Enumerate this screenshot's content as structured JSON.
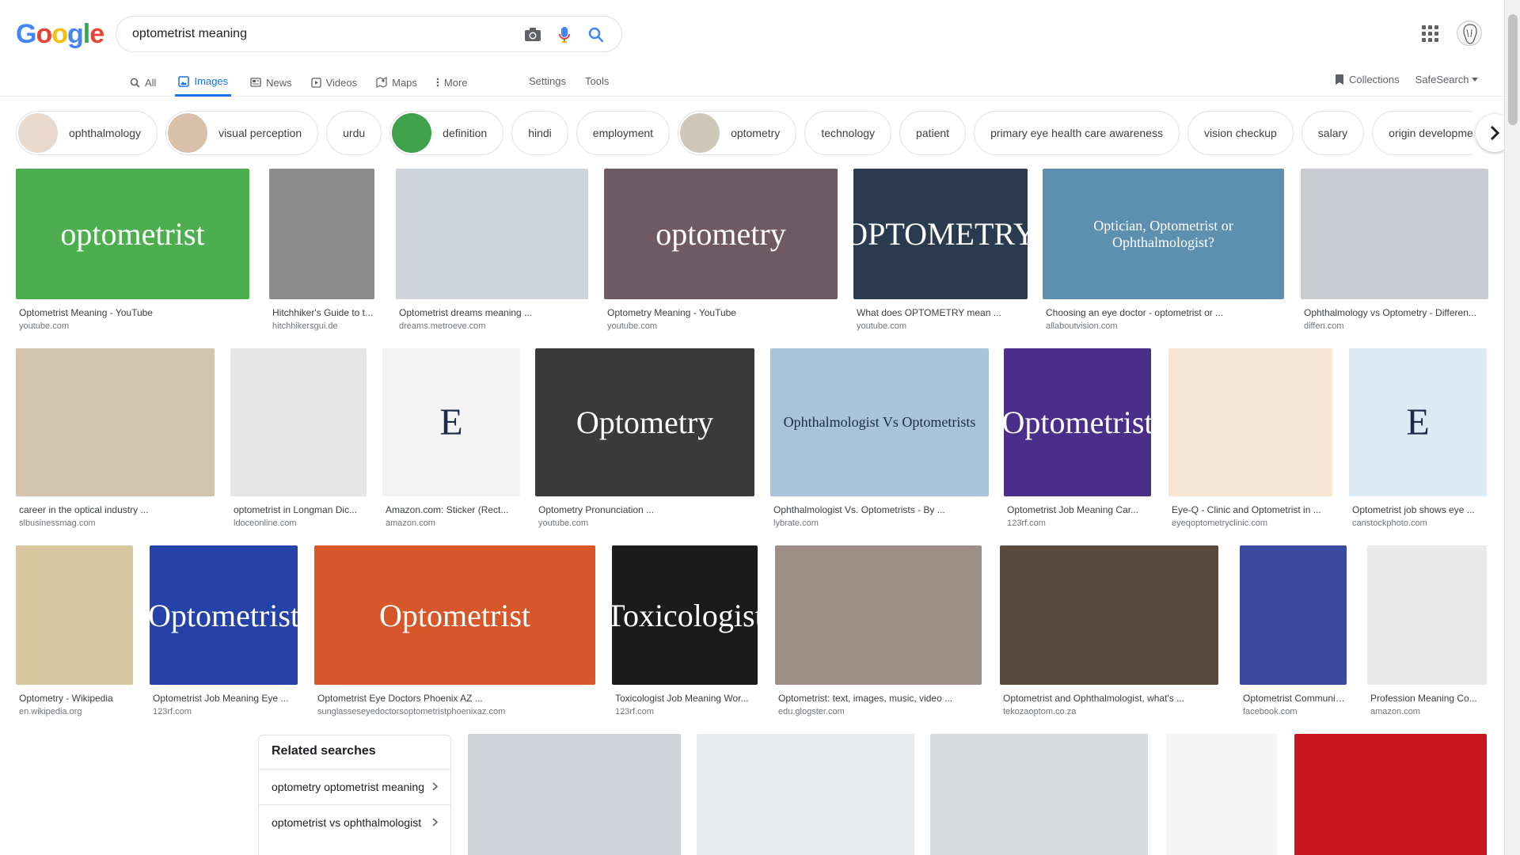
{
  "header": {
    "logo_letters": [
      {
        "ch": "G",
        "color": "#4285F4"
      },
      {
        "ch": "o",
        "color": "#EA4335"
      },
      {
        "ch": "o",
        "color": "#FBBC05"
      },
      {
        "ch": "g",
        "color": "#4285F4"
      },
      {
        "ch": "l",
        "color": "#34A853"
      },
      {
        "ch": "e",
        "color": "#EA4335"
      }
    ],
    "search_query": "optometrist meaning"
  },
  "nav": {
    "tabs": [
      {
        "label": "All",
        "icon": "search-icon",
        "active": false
      },
      {
        "label": "Images",
        "icon": "image-icon",
        "active": true
      },
      {
        "label": "News",
        "icon": "news-icon",
        "active": false
      },
      {
        "label": "Videos",
        "icon": "video-icon",
        "active": false
      },
      {
        "label": "Maps",
        "icon": "map-icon",
        "active": false
      },
      {
        "label": "More",
        "icon": "more-icon",
        "active": false
      }
    ],
    "settings": "Settings",
    "tools": "Tools",
    "collections": "Collections",
    "safesearch": "SafeSearch"
  },
  "chips": [
    {
      "label": "ophthalmology",
      "thumb": true,
      "thumb_color": "#e8d9cc"
    },
    {
      "label": "visual perception",
      "thumb": true,
      "thumb_color": "#d9c0a8"
    },
    {
      "label": "urdu",
      "thumb": false
    },
    {
      "label": "definition",
      "thumb": true,
      "thumb_color": "#3fa24a"
    },
    {
      "label": "hindi",
      "thumb": false
    },
    {
      "label": "employment",
      "thumb": false
    },
    {
      "label": "optometry",
      "thumb": true,
      "thumb_color": "#cfc8b8"
    },
    {
      "label": "technology",
      "thumb": false
    },
    {
      "label": "patient",
      "thumb": false
    },
    {
      "label": "primary eye health care awareness",
      "thumb": false
    },
    {
      "label": "vision checkup",
      "thumb": false
    },
    {
      "label": "salary",
      "thumb": false
    },
    {
      "label": "origin development",
      "thumb": false
    }
  ],
  "images": [
    {
      "title": "Optometrist Meaning - YouTube",
      "source": "youtube.com",
      "bg": "#4cae4f",
      "text": "optometrist"
    },
    {
      "title": "Hitchhiker's Guide to t...",
      "source": "hitchhikersgui.de",
      "bg": "#8c8c8c",
      "text": ""
    },
    {
      "title": "Optometrist dreams meaning ...",
      "source": "dreams.metroeve.com",
      "bg": "#cfd5db",
      "text": ""
    },
    {
      "title": "Optometry Meaning - YouTube",
      "source": "youtube.com",
      "bg": "#6f5a63",
      "text": "optometry"
    },
    {
      "title": "What does OPTOMETRY mean ...",
      "source": "youtube.com",
      "bg": "#2b3b4f",
      "text": "OPTOMETRY"
    },
    {
      "title": "Choosing an eye doctor - optometrist or ...",
      "source": "allaboutvision.com",
      "bg": "#5d8fb0",
      "text": "Optician, Optometrist or Ophthalmologist?"
    },
    {
      "title": "Ophthalmology vs Optometry - Differen...",
      "source": "diffen.com",
      "bg": "#c8ccd1",
      "text": ""
    },
    {
      "title": "career in the optical industry ...",
      "source": "slbusinessmag.com",
      "bg": "#d4c4ae",
      "text": ""
    },
    {
      "title": "optometrist in Longman Dic...",
      "source": "ldoceonline.com",
      "bg": "#e6e6e6",
      "text": ""
    },
    {
      "title": "Amazon.com: Sticker (Rect...",
      "source": "amazon.com",
      "bg": "#f3f3f3",
      "text": "E"
    },
    {
      "title": "Optometry Pronunciation ...",
      "source": "youtube.com",
      "bg": "#3a3a3a",
      "text": "Optometry"
    },
    {
      "title": "Ophthalmologist Vs. Optometrists - By ...",
      "source": "lybrate.com",
      "bg": "#a9c3dc",
      "text": "Ophthalmologist Vs Optometrists"
    },
    {
      "title": "Optometrist Job Meaning Car...",
      "source": "123rf.com",
      "bg": "#4b2d8a",
      "text": "Optometrist"
    },
    {
      "title": "Eye-Q - Clinic and Optometrist in ...",
      "source": "eyeqoptometryclinic.com",
      "bg": "#f7e6d4",
      "text": ""
    },
    {
      "title": "Optometrist job shows eye ...",
      "source": "canstockphoto.com",
      "bg": "#dbeaf3",
      "text": "E"
    },
    {
      "title": "Optometry - Wikipedia",
      "source": "en.wikipedia.org",
      "bg": "#d8c79e",
      "text": ""
    },
    {
      "title": "Optometrist Job Meaning Eye ...",
      "source": "123rf.com",
      "bg": "#2442a8",
      "text": "Optometrist"
    },
    {
      "title": "Optometrist Eye Doctors Phoenix AZ ...",
      "source": "sunglasseseyedoctorsoptometristphoenixaz.com",
      "bg": "#d8572a",
      "text": "Optometrist"
    },
    {
      "title": "Toxicologist Job Meaning Wor...",
      "source": "123rf.com",
      "bg": "#1b1b1b",
      "text": "Toxicologist"
    },
    {
      "title": "Optometrist: text, images, music, video ...",
      "source": "edu.glogster.com",
      "bg": "#9e8f86",
      "text": ""
    },
    {
      "title": "Optometrist and Ophthalmologist, what's ...",
      "source": "tekozaoptom.co.za",
      "bg": "#5a4a3e",
      "text": ""
    },
    {
      "title": "Optometrist Communit...",
      "source": "facebook.com",
      "bg": "#3b4a9e",
      "text": ""
    },
    {
      "title": "Profession Meaning Co...",
      "source": "amazon.com",
      "bg": "#e9e9e9",
      "text": ""
    },
    {
      "title": "",
      "source": "",
      "bg": "#ffffff",
      "text": ""
    },
    {
      "title": "",
      "source": "",
      "bg": "#cfd3d8",
      "text": ""
    },
    {
      "title": "",
      "source": "",
      "bg": "#e9ecef",
      "text": ""
    },
    {
      "title": "",
      "source": "",
      "bg": "#d9dcdf",
      "text": ""
    },
    {
      "title": "",
      "source": "",
      "bg": "#f5f5f5",
      "text": ""
    },
    {
      "title": "",
      "source": "",
      "bg": "#c7161d",
      "text": ""
    }
  ],
  "related": {
    "heading": "Related searches",
    "items": [
      "optometry optometrist meaning",
      "optometrist vs ophthalmologist"
    ]
  }
}
